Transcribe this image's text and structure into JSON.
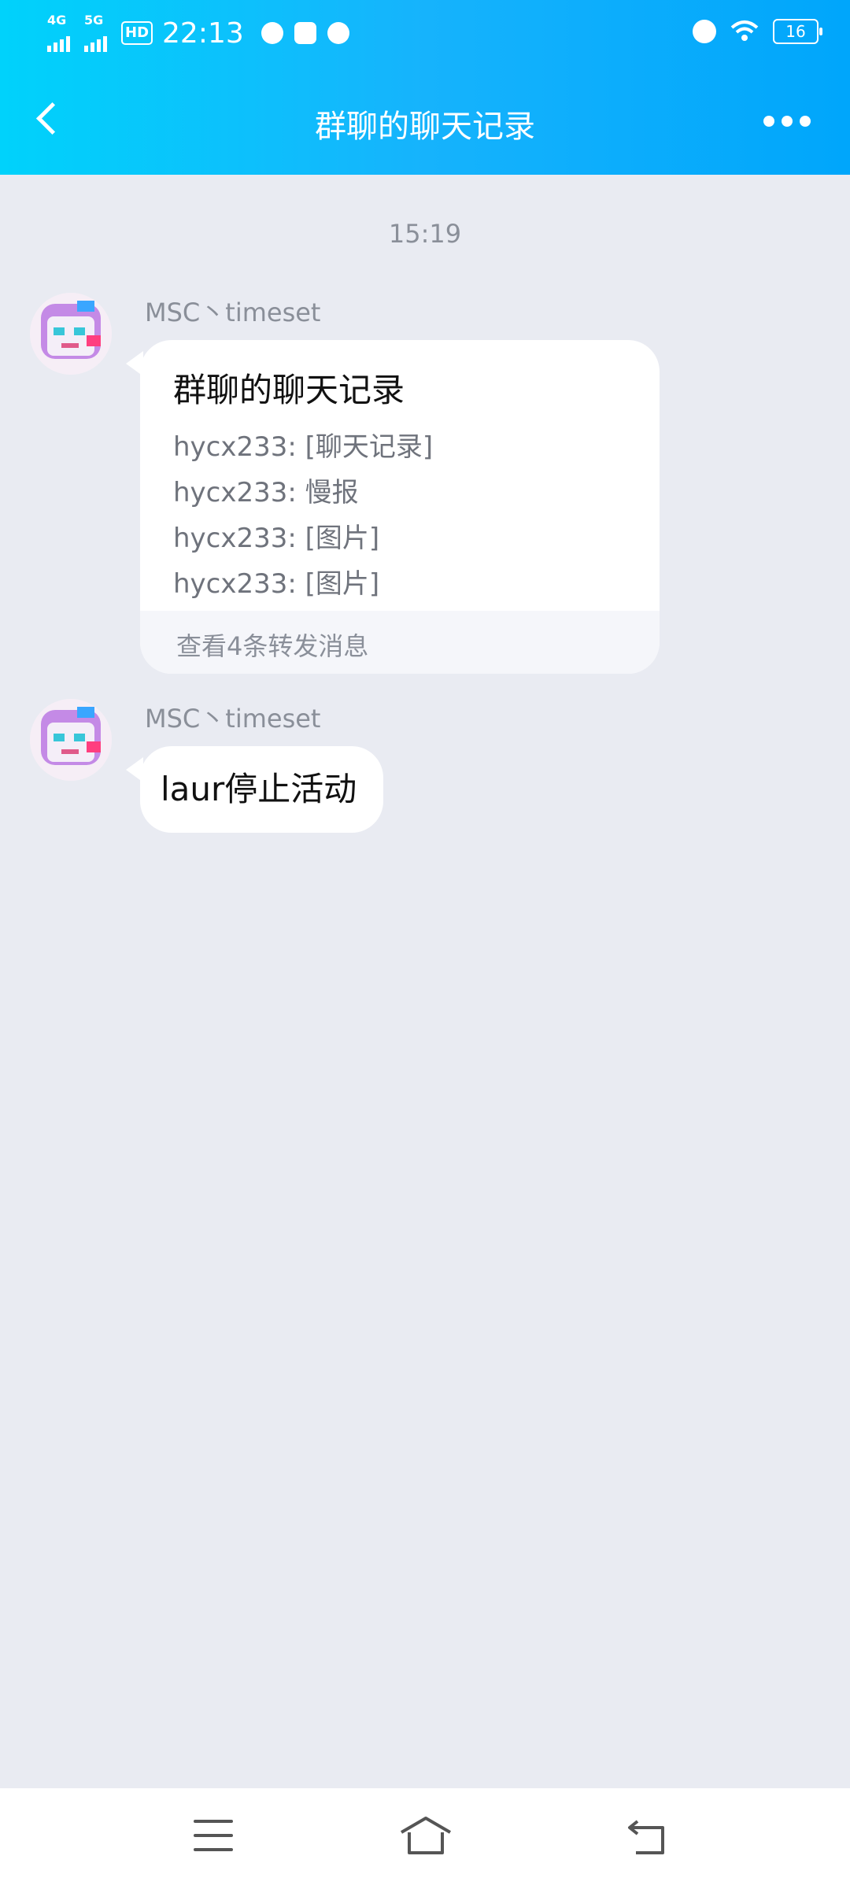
{
  "status_bar": {
    "network_1": "4G",
    "network_2": "5G",
    "hd": "HD",
    "time": "22:13",
    "battery": "16"
  },
  "header": {
    "title": "群聊的聊天记录"
  },
  "chat": {
    "timestamp": "15:19",
    "messages": [
      {
        "sender": "MSC丶timeset",
        "type": "forwarded-record",
        "card": {
          "title": "群聊的聊天记录",
          "lines": [
            "hycx233: [聊天记录]",
            "hycx233: 慢报",
            "hycx233: [图片]",
            "hycx233: [图片]"
          ],
          "footer": "查看4条转发消息"
        }
      },
      {
        "sender": "MSC丶timeset",
        "type": "text",
        "text": "laur停止活动"
      }
    ]
  },
  "colors": {
    "header_gradient_start": "#00d2fb",
    "header_gradient_end": "#00a6fb",
    "chat_background": "#e9ebf2",
    "bubble": "#ffffff"
  },
  "icons": {
    "back": "chevron-left-icon",
    "more": "more-dots-icon",
    "nav_menu": "menu-icon",
    "nav_home": "home-icon",
    "nav_back": "return-icon"
  }
}
